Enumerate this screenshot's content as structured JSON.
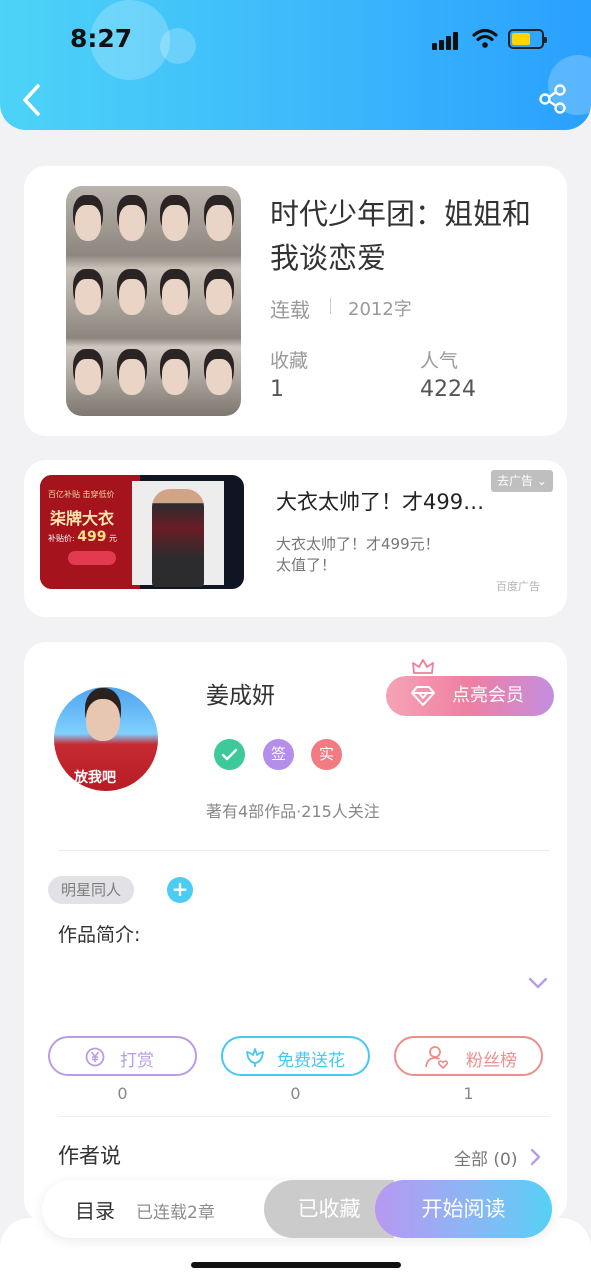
{
  "status_bar": {
    "time": "8:27"
  },
  "book": {
    "title": "时代少年团：姐姐和我谈恋爱",
    "status": "连载",
    "word_count": "2012字",
    "favorites_label": "收藏",
    "favorites_value": "1",
    "popularity_label": "人气",
    "popularity_value": "4224"
  },
  "ad": {
    "title": "大衣太帅了！才499…",
    "description": "大衣太帅了！才499元！太值了！",
    "remove_label": "去广告",
    "source": "百度广告",
    "banner_line1": "百亿补贴 击穿低价",
    "banner_line2": "柒牌大衣",
    "banner_price_label": "补贴价:",
    "banner_price": "499",
    "banner_unit": "元"
  },
  "author": {
    "name": "姜成妍",
    "avatar_caption": "放我吧",
    "vip_button": "点亮会员",
    "badges": [
      {
        "label": "",
        "color": "#3dc99a"
      },
      {
        "label": "签",
        "color": "#b48ee8"
      },
      {
        "label": "实",
        "color": "#f27b83"
      }
    ],
    "stats": "著有4部作品·215人关注"
  },
  "tags": [
    "明星同人"
  ],
  "intro_label": "作品简介:",
  "actions": [
    {
      "label": "打赏",
      "count": "0",
      "color": "#b99ce6"
    },
    {
      "label": "免费送花",
      "count": "0",
      "color": "#47c8f0"
    },
    {
      "label": "粉丝榜",
      "count": "1",
      "color": "#ef8c8c"
    }
  ],
  "author_says": {
    "title": "作者说",
    "all_label": "全部 (0)"
  },
  "bottom_bar": {
    "toc": "目录",
    "chapters": "已连载2章",
    "collected": "已收藏",
    "start_reading": "开始阅读"
  }
}
